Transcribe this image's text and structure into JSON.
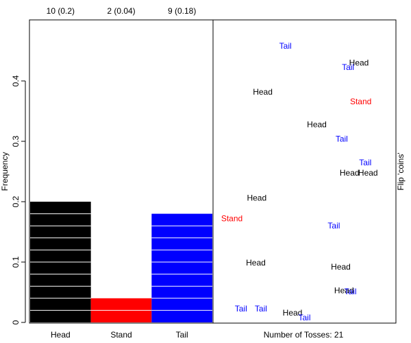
{
  "chart_data": {
    "type": "bar",
    "categories": [
      "Head",
      "Stand",
      "Tail"
    ],
    "counts": [
      10,
      2,
      9
    ],
    "values": [
      0.2,
      0.04,
      0.18
    ],
    "top_labels": [
      "10 (0.2)",
      "2 (0.04)",
      "9 (0.18)"
    ],
    "colors": [
      "#000000",
      "#ff0000",
      "#0000ff"
    ],
    "ylabel": "Frequency",
    "yticks": [
      0,
      0.1,
      0.2,
      0.3,
      0.4
    ],
    "ylim": [
      0,
      0.5
    ],
    "grid": false,
    "right_panel": {
      "title": "Flip 'coins'",
      "footer": "Number of Tosses: 21",
      "tosses": [
        {
          "label": "Tail",
          "color": "#0000ff",
          "x": 0.395,
          "y": 0.458
        },
        {
          "label": "Head",
          "color": "#000000",
          "x": 0.8,
          "y": 0.43
        },
        {
          "label": "Tail",
          "color": "#0000ff",
          "x": 0.74,
          "y": 0.423
        },
        {
          "label": "Head",
          "color": "#000000",
          "x": 0.27,
          "y": 0.382
        },
        {
          "label": "Stand",
          "color": "#ff0000",
          "x": 0.81,
          "y": 0.366
        },
        {
          "label": "Head",
          "color": "#000000",
          "x": 0.568,
          "y": 0.328
        },
        {
          "label": "Tail",
          "color": "#0000ff",
          "x": 0.705,
          "y": 0.304
        },
        {
          "label": "Tail",
          "color": "#0000ff",
          "x": 0.835,
          "y": 0.265
        },
        {
          "label": "Head",
          "color": "#000000",
          "x": 0.748,
          "y": 0.248
        },
        {
          "label": "Head",
          "color": "#000000",
          "x": 0.85,
          "y": 0.248
        },
        {
          "label": "Head",
          "color": "#000000",
          "x": 0.237,
          "y": 0.206
        },
        {
          "label": "Stand",
          "color": "#ff0000",
          "x": 0.1,
          "y": 0.172
        },
        {
          "label": "Tail",
          "color": "#0000ff",
          "x": 0.662,
          "y": 0.16
        },
        {
          "label": "Head",
          "color": "#000000",
          "x": 0.232,
          "y": 0.099
        },
        {
          "label": "Head",
          "color": "#000000",
          "x": 0.7,
          "y": 0.092
        },
        {
          "label": "Head",
          "color": "#000000",
          "x": 0.718,
          "y": 0.053
        },
        {
          "label": "Tail",
          "color": "#0000ff",
          "x": 0.753,
          "y": 0.051
        },
        {
          "label": "Tail",
          "color": "#0000ff",
          "x": 0.15,
          "y": 0.023
        },
        {
          "label": "Tail",
          "color": "#0000ff",
          "x": 0.26,
          "y": 0.023
        },
        {
          "label": "Head",
          "color": "#000000",
          "x": 0.434,
          "y": 0.016
        },
        {
          "label": "Tail",
          "color": "#0000ff",
          "x": 0.5,
          "y": 0.008
        }
      ]
    }
  }
}
